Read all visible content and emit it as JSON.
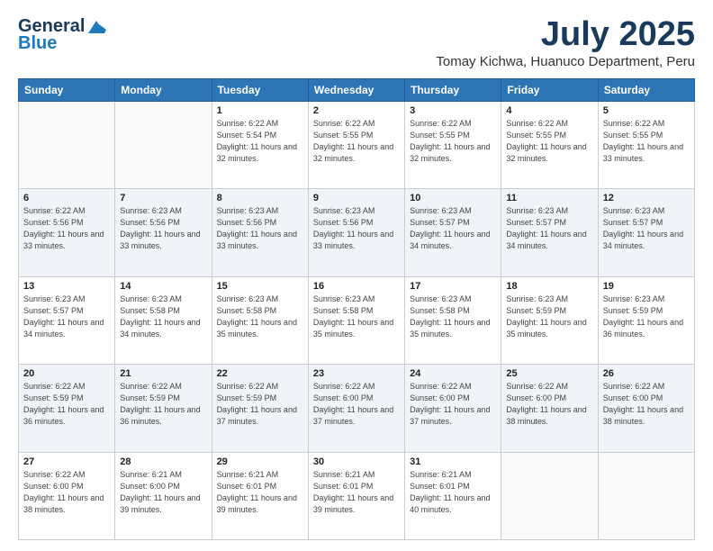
{
  "header": {
    "logo_line1": "General",
    "logo_line2": "Blue",
    "month": "July 2025",
    "location": "Tomay Kichwa, Huanuco Department, Peru"
  },
  "days_of_week": [
    "Sunday",
    "Monday",
    "Tuesday",
    "Wednesday",
    "Thursday",
    "Friday",
    "Saturday"
  ],
  "weeks": [
    [
      {
        "day": "",
        "info": ""
      },
      {
        "day": "",
        "info": ""
      },
      {
        "day": "1",
        "info": "Sunrise: 6:22 AM\nSunset: 5:54 PM\nDaylight: 11 hours and 32 minutes."
      },
      {
        "day": "2",
        "info": "Sunrise: 6:22 AM\nSunset: 5:55 PM\nDaylight: 11 hours and 32 minutes."
      },
      {
        "day": "3",
        "info": "Sunrise: 6:22 AM\nSunset: 5:55 PM\nDaylight: 11 hours and 32 minutes."
      },
      {
        "day": "4",
        "info": "Sunrise: 6:22 AM\nSunset: 5:55 PM\nDaylight: 11 hours and 32 minutes."
      },
      {
        "day": "5",
        "info": "Sunrise: 6:22 AM\nSunset: 5:55 PM\nDaylight: 11 hours and 33 minutes."
      }
    ],
    [
      {
        "day": "6",
        "info": "Sunrise: 6:22 AM\nSunset: 5:56 PM\nDaylight: 11 hours and 33 minutes."
      },
      {
        "day": "7",
        "info": "Sunrise: 6:23 AM\nSunset: 5:56 PM\nDaylight: 11 hours and 33 minutes."
      },
      {
        "day": "8",
        "info": "Sunrise: 6:23 AM\nSunset: 5:56 PM\nDaylight: 11 hours and 33 minutes."
      },
      {
        "day": "9",
        "info": "Sunrise: 6:23 AM\nSunset: 5:56 PM\nDaylight: 11 hours and 33 minutes."
      },
      {
        "day": "10",
        "info": "Sunrise: 6:23 AM\nSunset: 5:57 PM\nDaylight: 11 hours and 34 minutes."
      },
      {
        "day": "11",
        "info": "Sunrise: 6:23 AM\nSunset: 5:57 PM\nDaylight: 11 hours and 34 minutes."
      },
      {
        "day": "12",
        "info": "Sunrise: 6:23 AM\nSunset: 5:57 PM\nDaylight: 11 hours and 34 minutes."
      }
    ],
    [
      {
        "day": "13",
        "info": "Sunrise: 6:23 AM\nSunset: 5:57 PM\nDaylight: 11 hours and 34 minutes."
      },
      {
        "day": "14",
        "info": "Sunrise: 6:23 AM\nSunset: 5:58 PM\nDaylight: 11 hours and 34 minutes."
      },
      {
        "day": "15",
        "info": "Sunrise: 6:23 AM\nSunset: 5:58 PM\nDaylight: 11 hours and 35 minutes."
      },
      {
        "day": "16",
        "info": "Sunrise: 6:23 AM\nSunset: 5:58 PM\nDaylight: 11 hours and 35 minutes."
      },
      {
        "day": "17",
        "info": "Sunrise: 6:23 AM\nSunset: 5:58 PM\nDaylight: 11 hours and 35 minutes."
      },
      {
        "day": "18",
        "info": "Sunrise: 6:23 AM\nSunset: 5:59 PM\nDaylight: 11 hours and 35 minutes."
      },
      {
        "day": "19",
        "info": "Sunrise: 6:23 AM\nSunset: 5:59 PM\nDaylight: 11 hours and 36 minutes."
      }
    ],
    [
      {
        "day": "20",
        "info": "Sunrise: 6:22 AM\nSunset: 5:59 PM\nDaylight: 11 hours and 36 minutes."
      },
      {
        "day": "21",
        "info": "Sunrise: 6:22 AM\nSunset: 5:59 PM\nDaylight: 11 hours and 36 minutes."
      },
      {
        "day": "22",
        "info": "Sunrise: 6:22 AM\nSunset: 5:59 PM\nDaylight: 11 hours and 37 minutes."
      },
      {
        "day": "23",
        "info": "Sunrise: 6:22 AM\nSunset: 6:00 PM\nDaylight: 11 hours and 37 minutes."
      },
      {
        "day": "24",
        "info": "Sunrise: 6:22 AM\nSunset: 6:00 PM\nDaylight: 11 hours and 37 minutes."
      },
      {
        "day": "25",
        "info": "Sunrise: 6:22 AM\nSunset: 6:00 PM\nDaylight: 11 hours and 38 minutes."
      },
      {
        "day": "26",
        "info": "Sunrise: 6:22 AM\nSunset: 6:00 PM\nDaylight: 11 hours and 38 minutes."
      }
    ],
    [
      {
        "day": "27",
        "info": "Sunrise: 6:22 AM\nSunset: 6:00 PM\nDaylight: 11 hours and 38 minutes."
      },
      {
        "day": "28",
        "info": "Sunrise: 6:21 AM\nSunset: 6:00 PM\nDaylight: 11 hours and 39 minutes."
      },
      {
        "day": "29",
        "info": "Sunrise: 6:21 AM\nSunset: 6:01 PM\nDaylight: 11 hours and 39 minutes."
      },
      {
        "day": "30",
        "info": "Sunrise: 6:21 AM\nSunset: 6:01 PM\nDaylight: 11 hours and 39 minutes."
      },
      {
        "day": "31",
        "info": "Sunrise: 6:21 AM\nSunset: 6:01 PM\nDaylight: 11 hours and 40 minutes."
      },
      {
        "day": "",
        "info": ""
      },
      {
        "day": "",
        "info": ""
      }
    ]
  ]
}
